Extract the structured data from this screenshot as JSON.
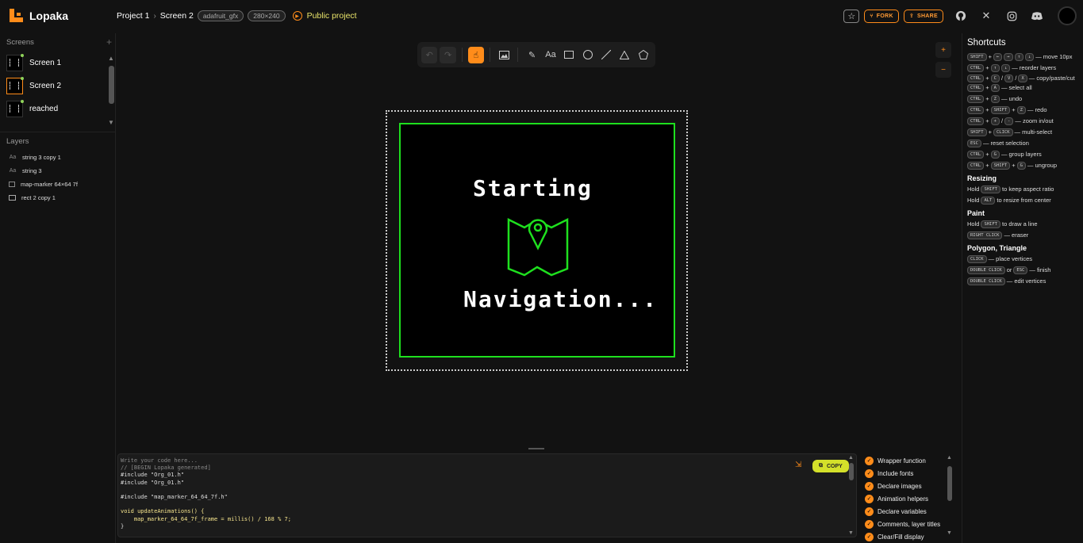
{
  "app": {
    "name": "Lopaka"
  },
  "breadcrumb": {
    "project": "Project 1",
    "screen": "Screen 2",
    "platform_tag": "adafruit_gfx",
    "size_tag": "280×240",
    "public_label": "Public project"
  },
  "topbar": {
    "fork_label": "FORK",
    "share_label": "SHARE"
  },
  "sidebar": {
    "screens_title": "Screens",
    "screens": [
      {
        "label": "Screen 1"
      },
      {
        "label": "Screen 2"
      },
      {
        "label": "reached"
      }
    ],
    "layers_title": "Layers",
    "layers": [
      {
        "label": "string 3 copy 1",
        "icon": "text-icon"
      },
      {
        "label": "string 3",
        "icon": "text-icon"
      },
      {
        "label": "map-marker 64×64 7f",
        "icon": "image-icon"
      },
      {
        "label": "rect 2 copy 1",
        "icon": "rectangle-icon"
      }
    ]
  },
  "canvas": {
    "text_top": "Starting",
    "text_bottom": "Navigation...",
    "accent_color": "#1ee01e"
  },
  "code": {
    "lines": [
      {
        "text": "Write your code here...",
        "cls": "c-comment"
      },
      {
        "text": "// [BEGIN Lopaka generated]",
        "cls": "c-comment"
      },
      {
        "text": "#include \"Org_01.h\"",
        "cls": "c-inc"
      },
      {
        "text": "#include \"Org_01.h\"",
        "cls": "c-inc"
      },
      {
        "text": "",
        "cls": ""
      },
      {
        "text": "#include \"map_marker_64_64_7f.h\"",
        "cls": "c-inc"
      },
      {
        "text": "",
        "cls": ""
      },
      {
        "text": "void updateAnimations() {",
        "cls": "c-fn"
      },
      {
        "text": "    map_marker_64_64_7f_frame = millis() / 168 % 7;",
        "cls": "c-fn"
      },
      {
        "text": "}",
        "cls": ""
      }
    ],
    "copy_label": "COPY"
  },
  "options": [
    "Wrapper function",
    "Include fonts",
    "Declare images",
    "Animation helpers",
    "Declare variables",
    "Comments, layer titles",
    "Clear/Fill display"
  ],
  "shortcuts": {
    "title": "Shortcuts",
    "move": "— move 10px",
    "reorder": "— reorder layers",
    "copy": "— copy/paste/cut",
    "select_all": "— select all",
    "undo": "— undo",
    "redo": "— redo",
    "zoom": "— zoom in/out",
    "multi": "— multi-select",
    "reset": "— reset selection",
    "group": "— group layers",
    "ungroup": "— ungroup",
    "resizing_title": "Resizing",
    "aspect": "to keep aspect ratio",
    "center": "to resize from center",
    "paint_title": "Paint",
    "draw_line": "to draw a line",
    "eraser": "— eraser",
    "polygon_title": "Polygon, Triangle",
    "place": "— place vertices",
    "finish": "— finish",
    "edit": "— edit vertices",
    "hold": "Hold",
    "or": "or"
  }
}
